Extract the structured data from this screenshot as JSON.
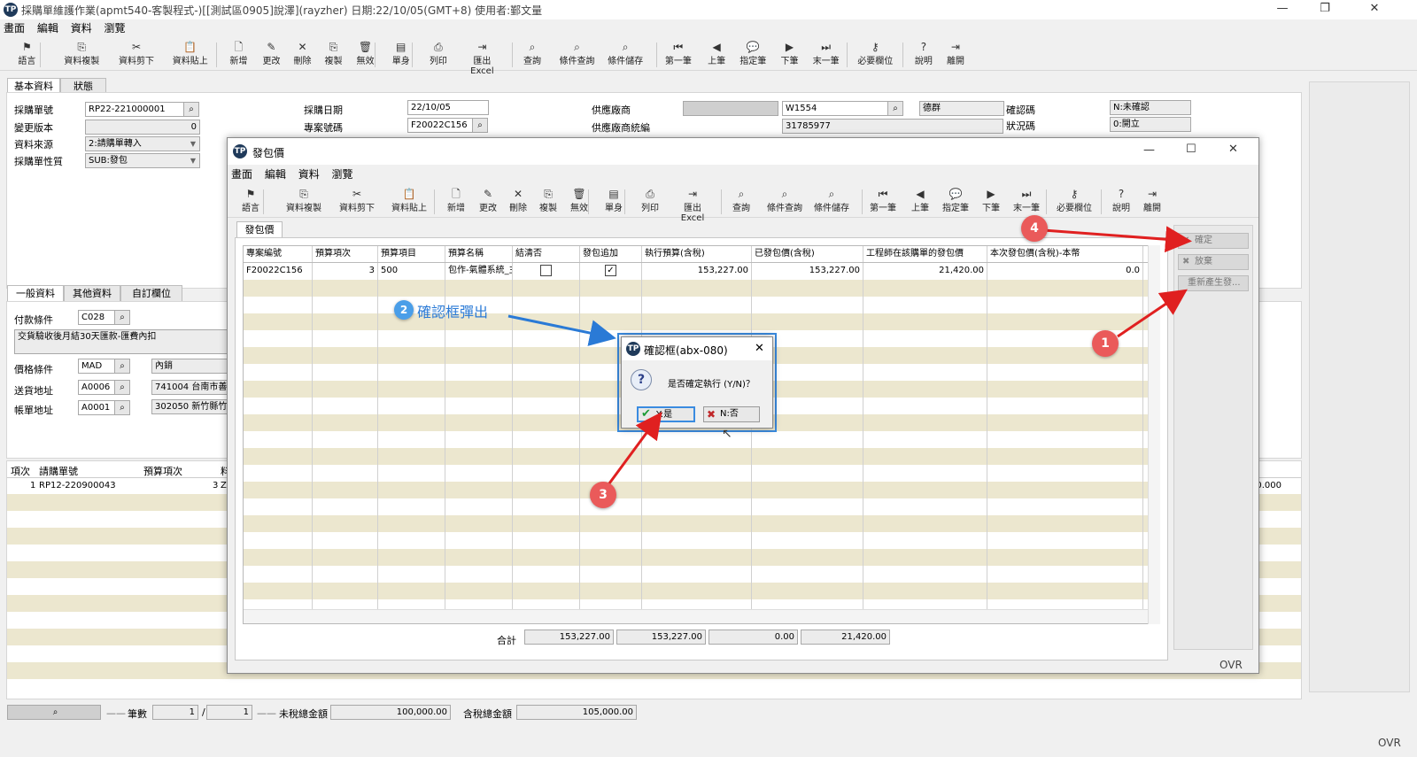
{
  "app": {
    "logo": "TP",
    "title": "採購單維護作業(apmt540-客製程式-)[[測試區0905]說澤](rayzher) 日期:22/10/05(GMT+8) 使用者:鄞文量",
    "controls": {
      "minimize": "—",
      "maximize": "❐",
      "close": "✕"
    }
  },
  "menu": [
    "畫面",
    "編輯",
    "資料",
    "瀏覽"
  ],
  "toolbar": [
    {
      "label": "語言",
      "icon": "⚑"
    },
    {
      "label": "資料複製",
      "icon": "⎘"
    },
    {
      "label": "資料剪下",
      "icon": "✂"
    },
    {
      "label": "資料貼上",
      "icon": "📋"
    },
    {
      "label": "新增",
      "icon": "🗋"
    },
    {
      "label": "更改",
      "icon": "✎"
    },
    {
      "label": "刪除",
      "icon": "✕"
    },
    {
      "label": "複製",
      "icon": "⎘"
    },
    {
      "label": "無效",
      "icon": "🗑"
    },
    {
      "label": "單身",
      "icon": "▤"
    },
    {
      "label": "列印",
      "icon": "⎙"
    },
    {
      "label": "匯出Excel",
      "icon": "⇥"
    },
    {
      "label": "查詢",
      "icon": "⌕"
    },
    {
      "label": "條件查詢",
      "icon": "⌕"
    },
    {
      "label": "條件儲存",
      "icon": "⌕"
    },
    {
      "label": "第一筆",
      "icon": "⏮"
    },
    {
      "label": "上筆",
      "icon": "◀"
    },
    {
      "label": "指定筆",
      "icon": "💬"
    },
    {
      "label": "下筆",
      "icon": "▶"
    },
    {
      "label": "末一筆",
      "icon": "⏭"
    },
    {
      "label": "必要欄位",
      "icon": "⚷"
    },
    {
      "label": "說明",
      "icon": "?"
    },
    {
      "label": "離開",
      "icon": "⇥"
    }
  ],
  "main_tabs": [
    "基本資料",
    "狀態"
  ],
  "form": {
    "po_no_label": "採購單號",
    "po_no": "RP22-221000001",
    "version_label": "變更版本",
    "version": "0",
    "source_label": "資料來源",
    "source": "2:請購單轉入",
    "nature_label": "採購單性質",
    "nature": "SUB:發包",
    "date_label": "採購日期",
    "date": "22/10/05",
    "project_label": "專案號碼",
    "project": "F20022C156",
    "vendor_label": "供應廠商",
    "vendor": "W1554",
    "vendor_name": "德群",
    "vendor_tax_label": "供應廠商統編",
    "vendor_tax": "31785977",
    "confirm_label": "確認碼",
    "confirm": "N:未確認",
    "status_label": "狀況碼",
    "status": "0:開立"
  },
  "sub_tabs": [
    "一般資料",
    "其他資料",
    "自訂欄位"
  ],
  "general": {
    "payment_label": "付款條件",
    "payment": "C028",
    "payment_desc": "交貨驗收後月結30天匯款-匯費內扣",
    "price_label": "價格條件",
    "price": "MAD",
    "price_desc": "內銷",
    "ship_label": "送貨地址",
    "ship": "A0006",
    "ship_desc": "741004 台南市善化",
    "bill_label": "帳單地址",
    "bill": "A0001",
    "bill_desc": "302050 新竹縣竹北"
  },
  "lower_grid": {
    "headers": [
      "項次",
      "請購單號",
      "預算項次",
      "料"
    ],
    "row": [
      "1",
      "RP12-220900043",
      "3",
      "Z"
    ],
    "right_value": "00.000"
  },
  "footer": {
    "count_label": "筆數",
    "count_cur": "1",
    "slash": "/",
    "count_total": "1",
    "untaxed_label": "未稅總金額",
    "untaxed": "100,000.00",
    "taxed_label": "含稅總金額",
    "taxed": "105,000.00",
    "ovr": "OVR"
  },
  "dialog": {
    "title": "發包價",
    "tab": "發包價",
    "columns": [
      "專案編號",
      "預算項次",
      "預算項目",
      "預算名稱",
      "結清否",
      "發包追加",
      "執行預算(含稅)",
      "已發包價(含稅)",
      "工程師在該購單的發包價",
      "本次發包價(含稅)-本幣"
    ],
    "row": [
      "F20022C156",
      "3",
      "500",
      "包作-氣體系統_主",
      "",
      "✓",
      "153,227.00",
      "153,227.00",
      "21,420.00",
      "0.0"
    ],
    "total_label": "合計",
    "totals": [
      "153,227.00",
      "153,227.00",
      "0.00",
      "21,420.00"
    ],
    "buttons": {
      "confirm": "確定",
      "abandon": "放棄",
      "regenerate": "重新產生發..."
    },
    "ovr": "OVR"
  },
  "confirm_box": {
    "title": "確認框(abx-080)",
    "message": "是否確定執行 (Y/N)？",
    "yes": "Y:是",
    "no": "N:否"
  },
  "annotations": {
    "b1": "1",
    "b2": "2",
    "b3": "3",
    "b4": "4",
    "callout": "確認框彈出",
    "arrow_red": "#e02020",
    "arrow_blue": "#2a7ad6"
  }
}
